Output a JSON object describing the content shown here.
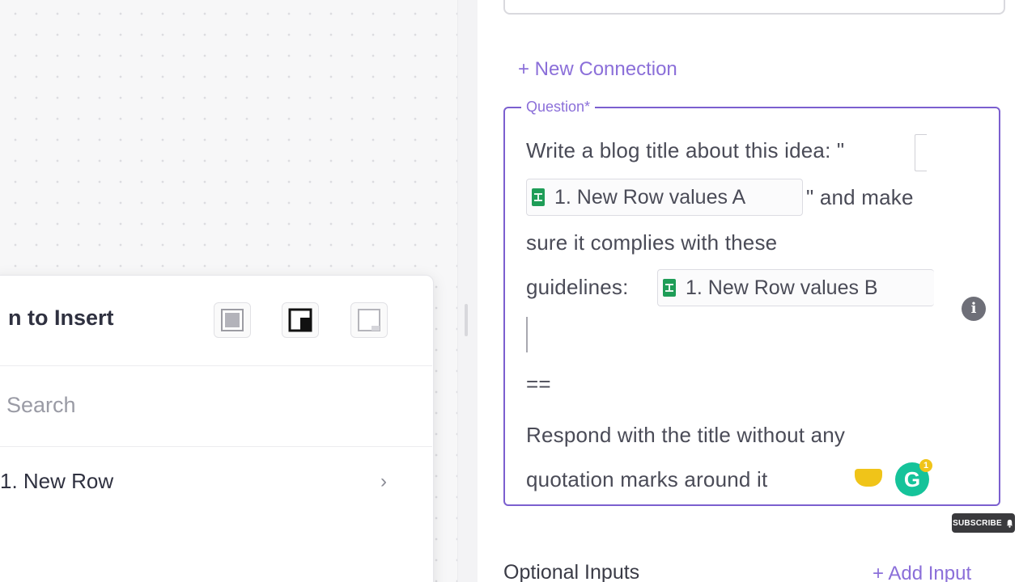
{
  "insert_panel": {
    "title": "n to Insert",
    "layout_options": [
      "layout-full-icon",
      "layout-corner-icon",
      "layout-empty-icon"
    ],
    "search_placeholder": "Search",
    "items": [
      {
        "label": "1. New Row",
        "chevron": "›"
      }
    ]
  },
  "right_panel": {
    "new_connection_label": "+ New Connection",
    "question": {
      "label": "Question*",
      "line1": "Write a blog title about this idea: \"",
      "chip_a": "1. New Row values A",
      "line2_rest": "\" and make",
      "line3": "sure it complies with these",
      "line4": "guidelines:",
      "chip_b": "1. New Row values B",
      "separator": "==",
      "line6": "Respond with the title without any",
      "line7": "quotation marks around it"
    },
    "info_icon": "i",
    "grammarly_label": "G",
    "grammarly_count": "1",
    "optional_inputs_label": "Optional Inputs",
    "add_input_label": "+ Add Input"
  },
  "overlay": {
    "subscribe_label": "SUBSCRIBE"
  },
  "colors": {
    "accent": "#7b5fcf",
    "link": "#8b6fd9",
    "sheets_green": "#1e9d57"
  }
}
